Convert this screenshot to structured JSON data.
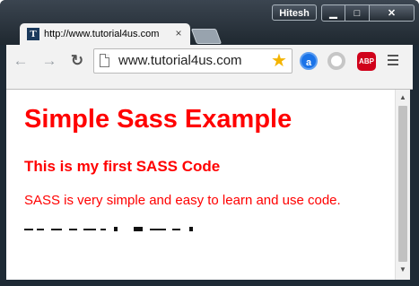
{
  "window": {
    "profile_name": "Hitesh",
    "min_glyph": "▁",
    "max_glyph": "□",
    "close_glyph": "✕"
  },
  "tab": {
    "favicon_letter": "T",
    "title": "http://www.tutorial4us.com",
    "close_glyph": "×"
  },
  "toolbar": {
    "back_glyph": "←",
    "forward_glyph": "→",
    "reload_glyph": "↻",
    "url": "www.tutorial4us.com",
    "star_glyph": "★",
    "ext_a_letter": "a",
    "ext_abp_label": "ABP"
  },
  "page": {
    "heading": "Simple Sass Example",
    "subheading": "This is my first SASS Code",
    "paragraph": "SASS is very simple and easy to learn and use code.",
    "text_color": "#ff0000"
  },
  "scrollbar": {
    "up_glyph": "▲",
    "down_glyph": "▼"
  }
}
